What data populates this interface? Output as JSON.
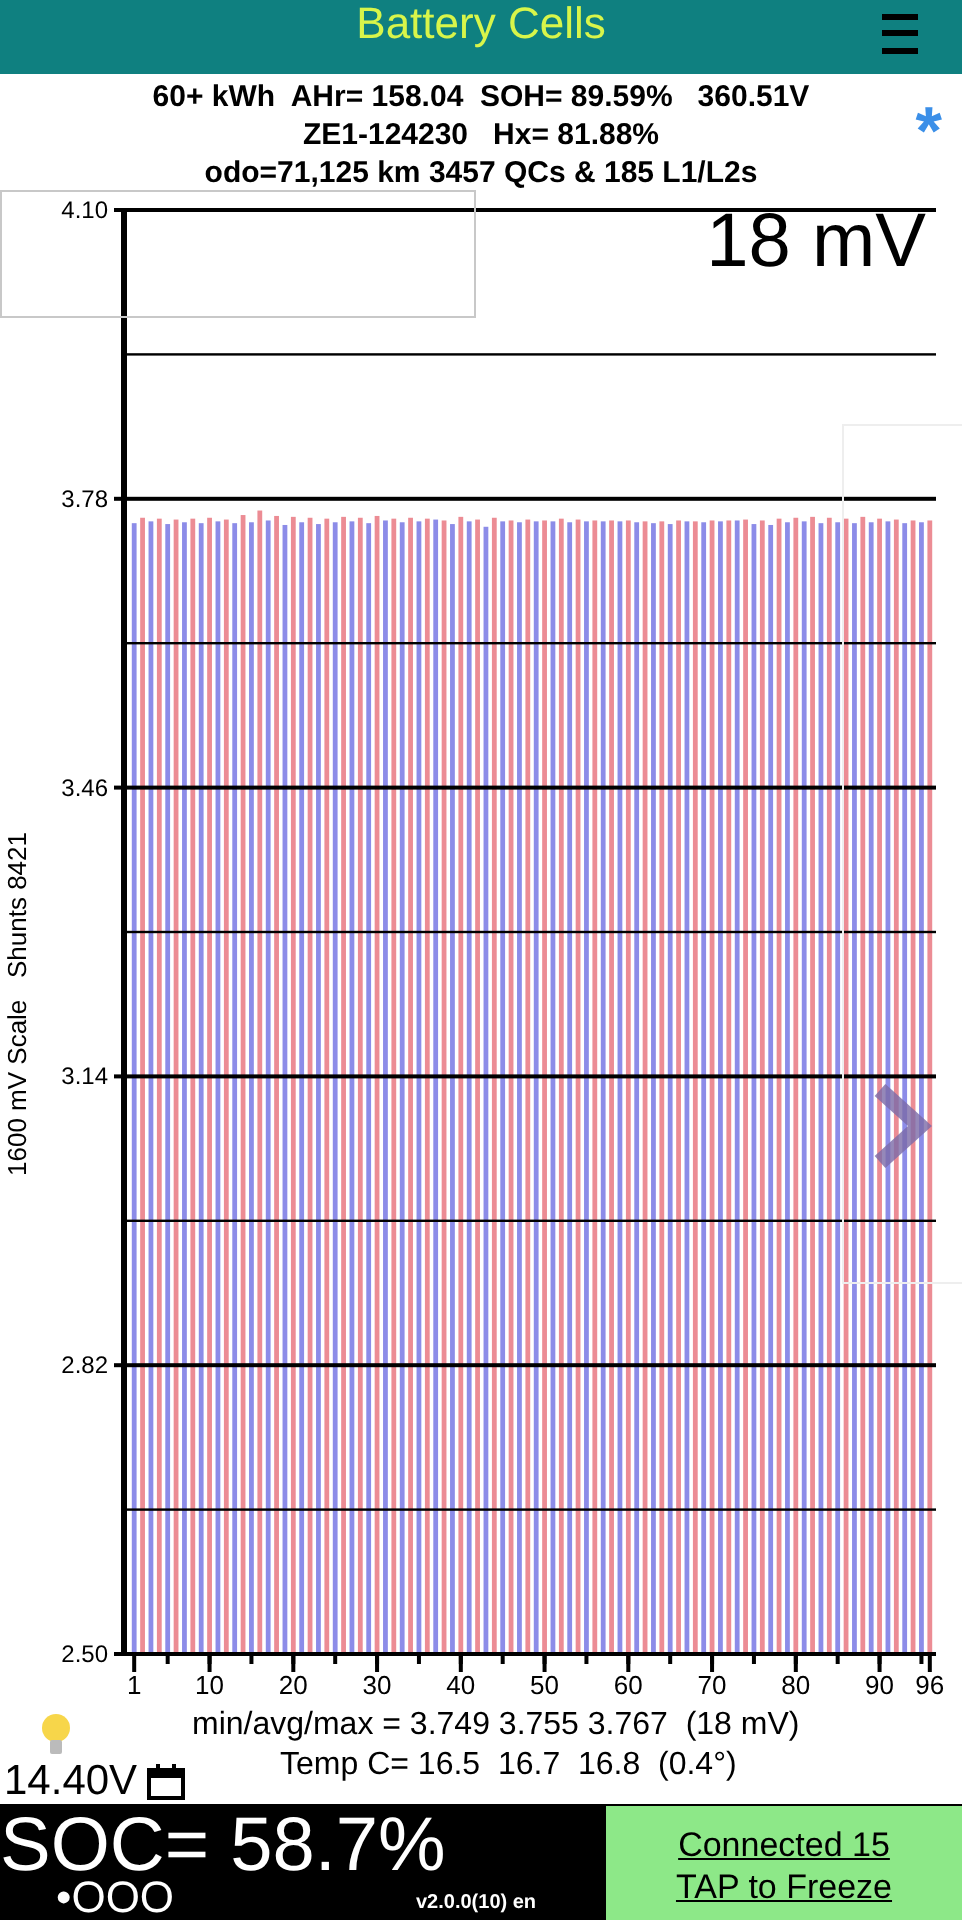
{
  "header": {
    "title": "Battery Cells"
  },
  "info": {
    "lines": [
      "60+ kWh  AHr= 158.04  SOH= 89.59%   360.51V",
      "ZE1-124230   Hx= 81.88%",
      "odo=71,125 km 3457 QCs & 185 L1/L2s"
    ],
    "link_mark": "*"
  },
  "chart": {
    "reading": "18 mV",
    "chart_data": {
      "type": "bar",
      "ylabel": "1600 mV Scale   Shunts 8421",
      "xlim": [
        1,
        96
      ],
      "ylim": [
        2.5,
        4.1
      ],
      "xticks": [
        1,
        10,
        20,
        30,
        40,
        50,
        60,
        70,
        80,
        90,
        96
      ],
      "yticks": [
        {
          "value": 2.5,
          "label": "2.50"
        },
        {
          "value": 2.82,
          "label": "2.82"
        },
        {
          "value": 3.14,
          "label": "3.14"
        },
        {
          "value": 3.46,
          "label": "3.46"
        },
        {
          "value": 3.78,
          "label": "3.78"
        },
        {
          "value": 4.1,
          "label": "4.10"
        }
      ],
      "x": [
        1,
        2,
        3,
        4,
        5,
        6,
        7,
        8,
        9,
        10,
        11,
        12,
        13,
        14,
        15,
        16,
        17,
        18,
        19,
        20,
        21,
        22,
        23,
        24,
        25,
        26,
        27,
        28,
        29,
        30,
        31,
        32,
        33,
        34,
        35,
        36,
        37,
        38,
        39,
        40,
        41,
        42,
        43,
        44,
        45,
        46,
        47,
        48,
        49,
        50,
        51,
        52,
        53,
        54,
        55,
        56,
        57,
        58,
        59,
        60,
        61,
        62,
        63,
        64,
        65,
        66,
        67,
        68,
        69,
        70,
        71,
        72,
        73,
        74,
        75,
        76,
        77,
        78,
        79,
        80,
        81,
        82,
        83,
        84,
        85,
        86,
        87,
        88,
        89,
        90,
        91,
        92,
        93,
        94,
        95,
        96
      ],
      "series": [
        {
          "color": "#8c8ce8",
          "values": [
            3.753,
            null,
            3.755,
            null,
            3.752,
            null,
            3.754,
            null,
            3.753,
            null,
            3.755,
            null,
            3.753,
            null,
            3.754,
            null,
            3.756,
            null,
            3.751,
            null,
            3.754,
            null,
            3.752,
            null,
            3.754,
            null,
            3.755,
            null,
            3.753,
            null,
            3.756,
            null,
            3.754,
            null,
            3.755,
            null,
            3.757,
            null,
            3.752,
            null,
            3.755,
            null,
            3.749,
            null,
            3.755,
            null,
            3.754,
            null,
            3.755,
            null,
            3.755,
            null,
            3.754,
            null,
            3.755,
            null,
            3.755,
            null,
            3.755,
            null,
            3.754,
            null,
            3.753,
            null,
            3.752,
            null,
            3.755,
            null,
            3.754,
            null,
            3.755,
            null,
            3.756,
            null,
            3.752,
            null,
            3.751,
            null,
            3.754,
            null,
            3.755,
            null,
            3.753,
            null,
            3.754,
            null,
            3.753,
            null,
            3.754,
            null,
            3.755,
            null,
            3.753,
            null,
            3.754,
            null
          ]
        },
        {
          "color": "#ec8c94",
          "values": [
            null,
            3.759,
            null,
            3.758,
            null,
            3.757,
            null,
            3.758,
            null,
            3.759,
            null,
            3.757,
            null,
            3.762,
            null,
            3.767,
            null,
            3.761,
            null,
            3.76,
            null,
            3.759,
            null,
            3.758,
            null,
            3.76,
            null,
            3.759,
            null,
            3.761,
            null,
            3.758,
            null,
            3.759,
            null,
            3.758,
            null,
            3.756,
            null,
            3.76,
            null,
            3.757,
            null,
            3.759,
            null,
            3.756,
            null,
            3.757,
            null,
            3.756,
            null,
            3.758,
            null,
            3.757,
            null,
            3.756,
            null,
            3.756,
            null,
            3.756,
            null,
            3.755,
            null,
            3.755,
            null,
            3.756,
            null,
            3.755,
            null,
            3.756,
            null,
            3.756,
            null,
            3.757,
            null,
            3.756,
            null,
            3.758,
            null,
            3.759,
            null,
            3.76,
            null,
            3.759,
            null,
            3.758,
            null,
            3.76,
            null,
            3.758,
            null,
            3.757,
            null,
            3.756,
            null,
            3.756
          ]
        }
      ]
    }
  },
  "stats": {
    "lines": [
      "min/avg/max = 3.749 3.755 3.767  (18 mV)",
      "Temp C= 16.5  16.7  16.8  (0.4°)"
    ],
    "voltage": "14.40V"
  },
  "footer": {
    "soc": "SOC= 58.7%",
    "indicator": "•OOO",
    "version": "v2.0.0(10) en",
    "button_lines": [
      "Connected 15",
      "TAP to Freeze"
    ]
  }
}
